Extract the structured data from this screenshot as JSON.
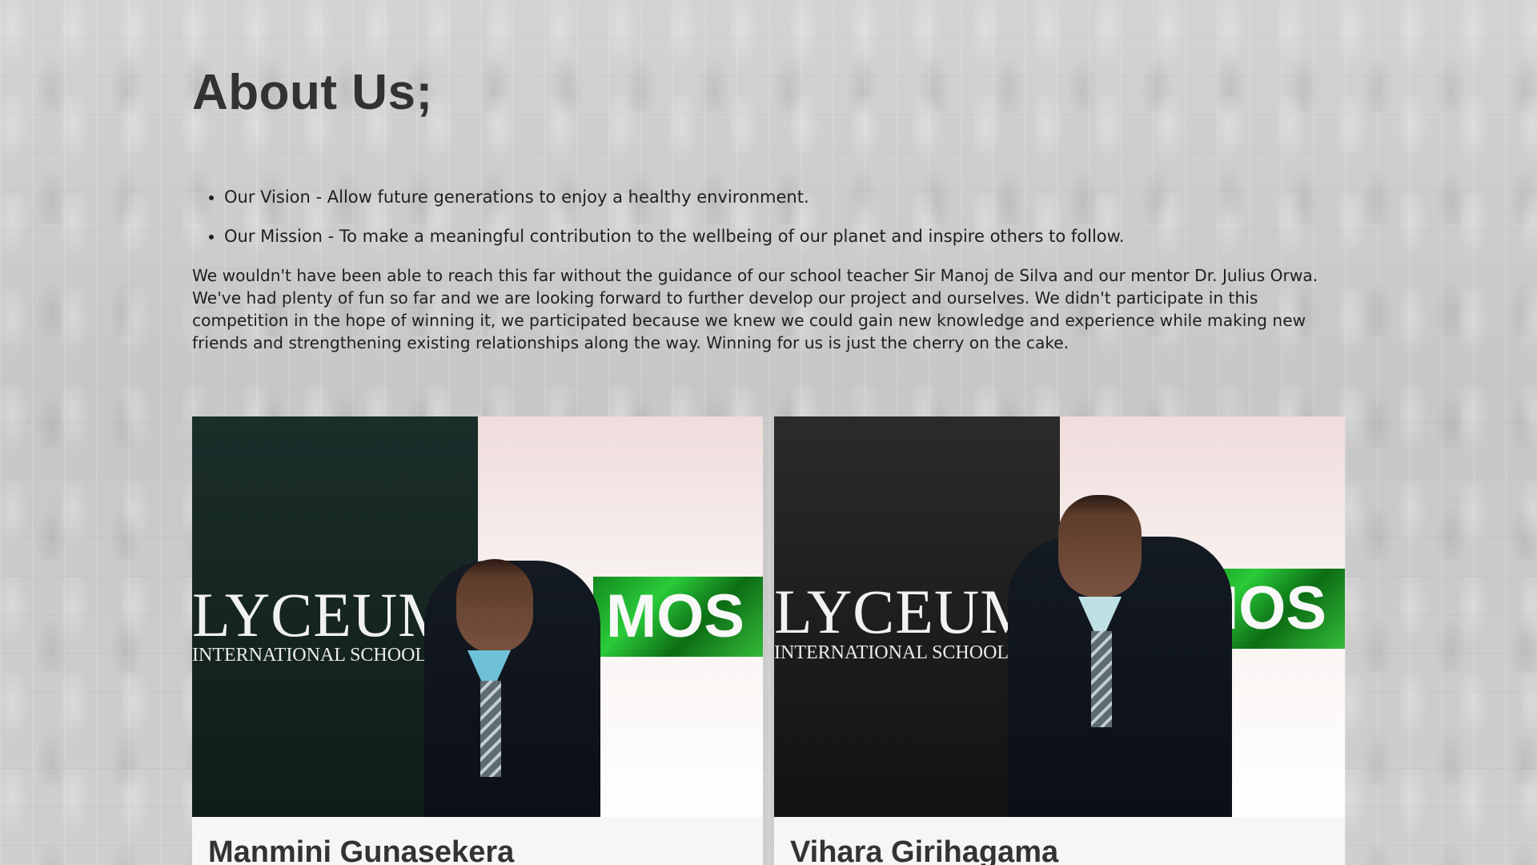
{
  "about": {
    "title": "About Us;",
    "goals": [
      "Our Vision - Allow future generations to enjoy a healthy environment.",
      "Our Mission - To make a meaningful contribution to the wellbeing of our planet and inspire others to follow."
    ],
    "paragraph": "We wouldn't have been able to reach this far without the guidance of our school teacher Sir Manoj de Silva and our mentor Dr. Julius Orwa. We've had plenty of fun so far and we are looking forward to further develop our project and ourselves. We didn't participate in this competition in the hope of winning it, we participated because we knew we could gain new knowledge and experience while making new friends and strengthening existing relationships along the way. Winning for us is just the cherry on the cake."
  },
  "members": [
    {
      "name": "Manmini Gunasekera",
      "photo": {
        "school_name": "LYCEUM",
        "school_subtitle": "INTERNATIONAL SCHOOLS",
        "banner_text": "MOS"
      }
    },
    {
      "name": "Vihara Girihagama",
      "photo": {
        "school_name": "LYCEUM",
        "school_subtitle": "INTERNATIONAL SCHOOL S",
        "banner_text": "MOS"
      }
    }
  ],
  "colors": {
    "title": "#323232",
    "text": "#1f1f1f",
    "banner_green": "#2aca39",
    "card_bg": "#f6f6f6"
  }
}
